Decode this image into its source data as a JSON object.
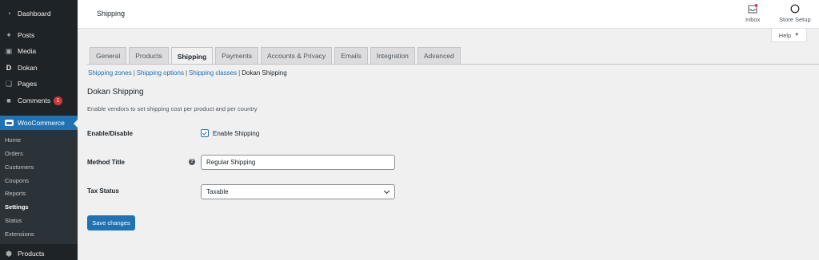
{
  "sidebar": {
    "items": [
      {
        "label": "Dashboard",
        "icon": "dashboard-icon"
      },
      {
        "label": "Posts",
        "icon": "pin-icon"
      },
      {
        "label": "Media",
        "icon": "media-icon"
      },
      {
        "label": "Dokan",
        "icon": "dokan-icon"
      },
      {
        "label": "Pages",
        "icon": "pages-icon"
      },
      {
        "label": "Comments",
        "icon": "comment-icon",
        "badge": "1"
      }
    ],
    "woocommerce": {
      "label": "WooCommerce"
    },
    "submenu": [
      "Home",
      "Orders",
      "Customers",
      "Coupons",
      "Reports",
      "Settings",
      "Status",
      "Extensions"
    ],
    "products": {
      "label": "Products"
    }
  },
  "header": {
    "title": "Shipping",
    "inbox": "Inbox",
    "store_setup": "Store Setup",
    "help": "Help"
  },
  "tabs": [
    "General",
    "Products",
    "Shipping",
    "Payments",
    "Accounts & Privacy",
    "Emails",
    "Integration",
    "Advanced"
  ],
  "active_tab": "Shipping",
  "subsub": {
    "links": [
      "Shipping zones",
      "Shipping options",
      "Shipping classes"
    ],
    "separator": "|",
    "current": "Dokan Shipping"
  },
  "section": {
    "title": "Dokan Shipping",
    "description": "Enable vendors to set shipping cost per product and per country"
  },
  "form": {
    "enable_label": "Enable/Disable",
    "enable_checkbox_label": "Enable Shipping",
    "enable_checked": true,
    "method_title_label": "Method Title",
    "method_title_value": "Regular Shipping",
    "tax_status_label": "Tax Status",
    "tax_status_value": "Taxable"
  },
  "save_button": "Save changes",
  "colors": {
    "accent": "#2271b1",
    "sidebar": "#1d2327",
    "badge": "#d63638"
  }
}
